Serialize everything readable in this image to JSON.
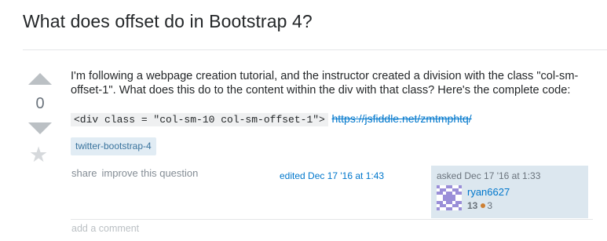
{
  "question": {
    "title": "What does offset do in Bootstrap 4?",
    "votes": "0",
    "body_text": "I'm following a webpage creation tutorial, and the instructor created a division with the class \"col-sm-offset-1\". What does this do to the content within the div with that class? Here's the complete code:",
    "code_snippet": "<div class = \"col-sm-10 col-sm-offset-1\">",
    "link_text": "https://jsfiddle.net/zmtmphtq/",
    "tags": [
      "twitter-bootstrap-4"
    ]
  },
  "post_menu": {
    "share_label": "share",
    "improve_label": "improve this question"
  },
  "edit_info": {
    "label": "edited Dec 17 '16 at 1:43"
  },
  "owner": {
    "asked_label": "asked Dec 17 '16 at 1:33",
    "name": "ryan6627",
    "reputation": "13",
    "bronze_badges": "3",
    "avatar_color": "#9a8ed8"
  },
  "comments": {
    "add_label": "add a comment"
  },
  "icons": {
    "upvote": "triangle-up-icon",
    "downvote": "triangle-down-icon",
    "favorite": "star-icon",
    "bronze_badge": "bronze-dot-icon"
  },
  "colors": {
    "link": "#0077cc",
    "tag_bg": "#e1ecf4",
    "tag_text": "#39739d",
    "owner_card_bg": "#dce7ef",
    "bronze": "#cd7f32"
  }
}
